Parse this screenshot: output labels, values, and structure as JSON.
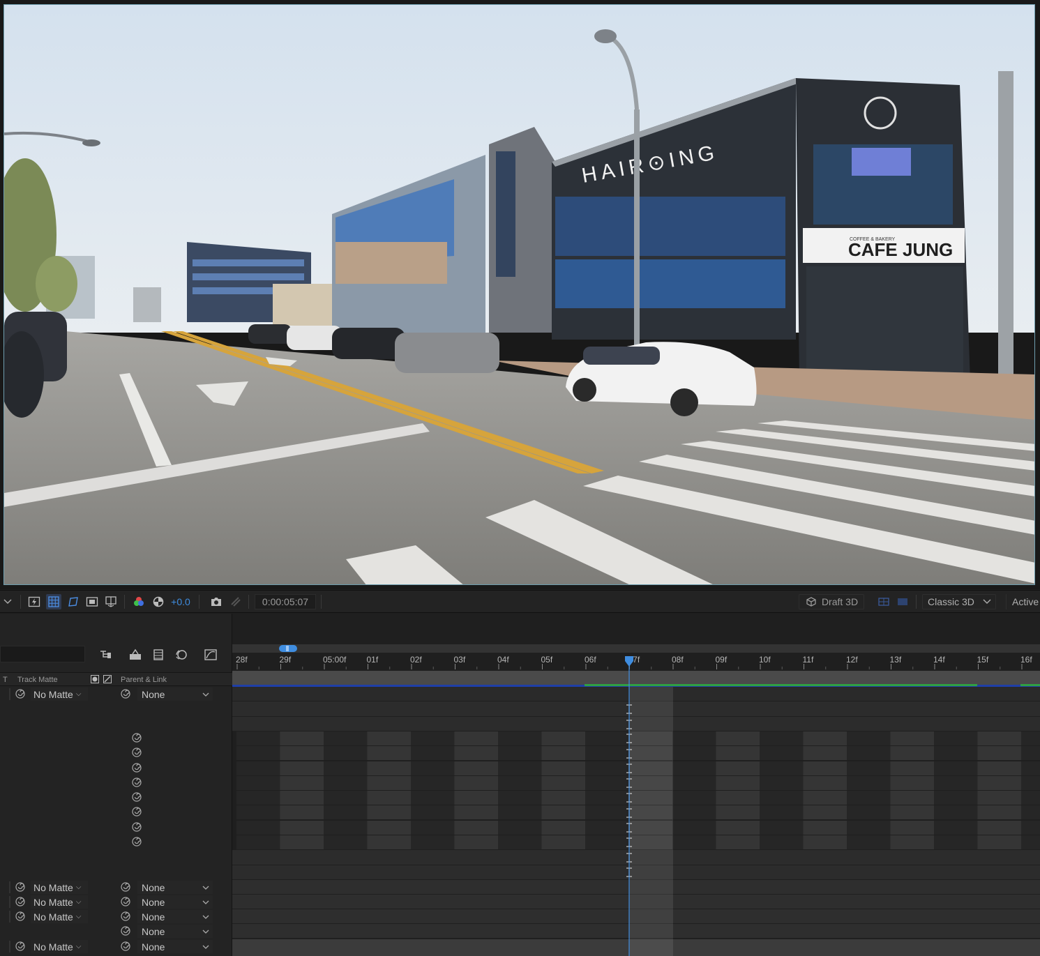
{
  "viewer": {
    "scene_signs": {
      "hair_sign": "HAIR⊙ING",
      "cafe_sign_small": "COFFEE & BAKERY",
      "cafe_sign": "CAFE JUNG"
    }
  },
  "viewer_toolbar": {
    "exposure": "+0.0",
    "timecode": "0:00:05:07",
    "draft_3d": "Draft 3D",
    "renderer": "Classic 3D",
    "camera": "Active"
  },
  "timeline": {
    "columns": {
      "t": "T",
      "track_matte": "Track Matte",
      "parent_link": "Parent & Link"
    },
    "ruler_labels": [
      "28f",
      "29f",
      "05:00f",
      "01f",
      "02f",
      "03f",
      "04f",
      "05f",
      "06f",
      "07f",
      "08f",
      "09f",
      "10f",
      "11f",
      "12f",
      "13f",
      "14f",
      "15f",
      "16f"
    ],
    "layers": [
      {
        "matte": "No Matte",
        "parent": "None"
      },
      {
        "matte": "No Matte",
        "parent": "None"
      },
      {
        "matte": "No Matte",
        "parent": "None"
      },
      {
        "matte": "No Matte",
        "parent": "None"
      },
      {
        "matte": "",
        "parent": "None"
      },
      {
        "matte": "No Matte",
        "parent": "None"
      }
    ],
    "colors": {
      "accent_blue": "#3f8de0",
      "layer_bar_blue": "#1f3fa8",
      "layer_bar_green": "#2fa043"
    }
  }
}
